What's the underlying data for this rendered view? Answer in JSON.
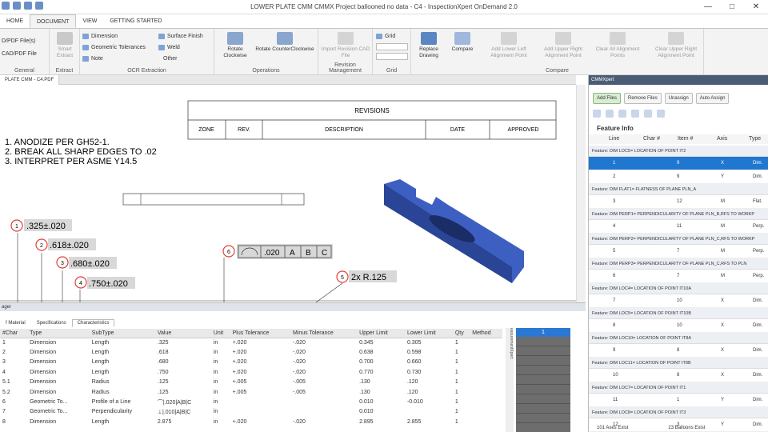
{
  "window": {
    "title": "LOWER PLATE CMM CMMX Project ballooned no data - C4 - InspectionXpert OnDemand 2.0"
  },
  "tabs": [
    "HOME",
    "DOCUMENT",
    "VIEW",
    "GETTING STARTED"
  ],
  "ribbon": {
    "general": {
      "items": [
        "D/PDF File(s)",
        "CAD/PDF File"
      ],
      "label": "General"
    },
    "extract": {
      "item": "Smart Extract",
      "label": "Extract"
    },
    "ocr": {
      "items": [
        "Dimension",
        "Geometric Tolerances",
        "Note",
        "Surface Finish",
        "Weld",
        "Other"
      ],
      "label": "OCR Extraction"
    },
    "operations": {
      "items": [
        "Rotate Clockwise",
        "Rotate CounterClockwise"
      ],
      "label": "Operations"
    },
    "revision": {
      "item": "Import Revision CAD File",
      "label": "Revision Management"
    },
    "grid": {
      "item": "Grid",
      "label": "Grid"
    },
    "compare": {
      "items": [
        "Replace Drawing",
        "Compare",
        "Add Lower Left Alignment Point",
        "Add Upper Right Alignment Point",
        "Clear All Alignment Points",
        "Clear Upper Right Alignment Point"
      ],
      "label": "Compare"
    }
  },
  "doc_tab": "PLATE CMM - C4.PDF",
  "drawing": {
    "revisions_title": "REVISIONS",
    "rev_cols": [
      "ZONE",
      "REV.",
      "DESCRIPTION",
      "DATE",
      "APPROVED"
    ],
    "notes": [
      "1.   ANODIZE PER GH52-1.",
      "2.   BREAK ALL SHARP EDGES TO .02",
      "3.   INTERPRET PER ASME Y14.5"
    ],
    "balloons": [
      {
        "n": "1",
        "text": ".325±.020"
      },
      {
        "n": "2",
        "text": ".618±.020"
      },
      {
        "n": "3",
        "text": ".680±.020"
      },
      {
        "n": "4",
        "text": ".750±.020"
      },
      {
        "n": "5",
        "text": "2x R.125"
      },
      {
        "n": "6",
        "text": ".020"
      }
    ],
    "fcf_refs": [
      "A",
      "B",
      "C"
    ]
  },
  "bottom": {
    "header": "ager",
    "tabs": [
      "f Material",
      "Specifications",
      "Characteristics"
    ],
    "columns": [
      "#Char",
      "Type",
      "SubType",
      "Value",
      "Unit",
      "Plus Tolerance",
      "Minus Tolerance",
      "Upper Limit",
      "Lower Limit",
      "Qty",
      "Method"
    ],
    "rows": [
      [
        "1",
        "Dimension",
        "Length",
        ".325",
        "in",
        "+.020",
        "-.020",
        "0.345",
        "0.305",
        "1",
        ""
      ],
      [
        "2",
        "Dimension",
        "Length",
        ".618",
        "in",
        "+.020",
        "-.020",
        "0.638",
        "0.598",
        "1",
        ""
      ],
      [
        "3",
        "Dimension",
        "Length",
        ".680",
        "in",
        "+.020",
        "-.020",
        "0.700",
        "0.660",
        "1",
        ""
      ],
      [
        "4",
        "Dimension",
        "Length",
        ".750",
        "in",
        "+.020",
        "-.020",
        "0.770",
        "0.730",
        "1",
        ""
      ],
      [
        "5.1",
        "Dimension",
        "Radius",
        ".125",
        "in",
        "+.005",
        "-.005",
        ".130",
        ".120",
        "1",
        ""
      ],
      [
        "5.2",
        "Dimension",
        "Radius",
        ".125",
        "in",
        "+.005",
        "-.005",
        ".130",
        ".120",
        "1",
        ""
      ],
      [
        "6",
        "Geometric To...",
        "Profile of a Line",
        "⌒|.020|A|B|C",
        "in",
        "",
        "",
        "0.010",
        "-0.010",
        "1",
        ""
      ],
      [
        "7",
        "Geometric To...",
        "Perpendicularity",
        "⊥|.010|A|B|C",
        "in",
        "",
        "",
        "0.010",
        "",
        "1",
        ""
      ],
      [
        "8",
        "Dimension",
        "Length",
        "2.875",
        "in",
        "+.020",
        "-.020",
        "2.895",
        "2.855",
        "1",
        ""
      ]
    ],
    "side_label": "easurementXpert",
    "blue_header": "1"
  },
  "cmmx": {
    "title": "CMMXpert",
    "buttons": [
      "Add Files",
      "Remove Files",
      "Unassign",
      "Auto Assign"
    ],
    "feature_info": "Feature Info",
    "cols": [
      "Line",
      "Char #",
      "Item #",
      "Axis",
      "Type"
    ],
    "groups": [
      {
        "feature": "Feature: DIM LOC5= LOCATION OF POINT IT2",
        "rows": [
          [
            "1",
            "9",
            "X",
            "Dim."
          ],
          [
            "2",
            "9",
            "Y",
            "Dim."
          ]
        ],
        "sel": 0
      },
      {
        "feature": "Feature: DIM FLAT1= FLATNESS OF PLANE PLN_A",
        "rows": [
          [
            "3",
            "12",
            "M",
            "Flat."
          ]
        ]
      },
      {
        "feature": "Feature: DIM PERP1= PERPENDICULARITY OF PLANE PLN_B,RFS TO WORKP",
        "rows": [
          [
            "4",
            "11",
            "M",
            "Perp."
          ]
        ]
      },
      {
        "feature": "Feature: DIM PERP2= PERPENDICULARITY OF PLANE PLN_C,RFS TO WORKP",
        "rows": [
          [
            "5",
            "7",
            "M",
            "Perp."
          ]
        ]
      },
      {
        "feature": "Feature: DIM PERP3= PERPENDICULARITY OF PLANE PLN_C,RFS TO PLN",
        "rows": [
          [
            "6",
            "7",
            "M",
            "Perp."
          ]
        ]
      },
      {
        "feature": "Feature: DIM LOC4= LOCATION OF POINT IT10A",
        "rows": [
          [
            "7",
            "10",
            "X",
            "Dim."
          ]
        ]
      },
      {
        "feature": "Feature: DIM LOC5= LOCATION OF POINT IT10B",
        "rows": [
          [
            "8",
            "10",
            "X",
            "Dim."
          ]
        ]
      },
      {
        "feature": "Feature: DIM LOC10= LOCATION OF POINT IT8A",
        "rows": [
          [
            "9",
            "8",
            "X",
            "Dim."
          ]
        ]
      },
      {
        "feature": "Feature: DIM LOC11= LOCATION OF POINT IT8B",
        "rows": [
          [
            "10",
            "8",
            "X",
            "Dim."
          ]
        ]
      },
      {
        "feature": "Feature: DIM LOC7= LOCATION OF POINT IT1",
        "rows": [
          [
            "11",
            "1",
            "Y",
            "Dim."
          ]
        ]
      },
      {
        "feature": "Feature: DIM LOC8= LOCATION OF POINT IT3",
        "rows": [
          [
            "12",
            "3",
            "Y",
            "Dim."
          ]
        ]
      }
    ],
    "footer": [
      "101 Axes Exist",
      "23 Balloons Exist"
    ]
  },
  "colors": {
    "accent": "#2a78d4",
    "balloon": "#e0413a",
    "part": "#3d5fc2"
  }
}
